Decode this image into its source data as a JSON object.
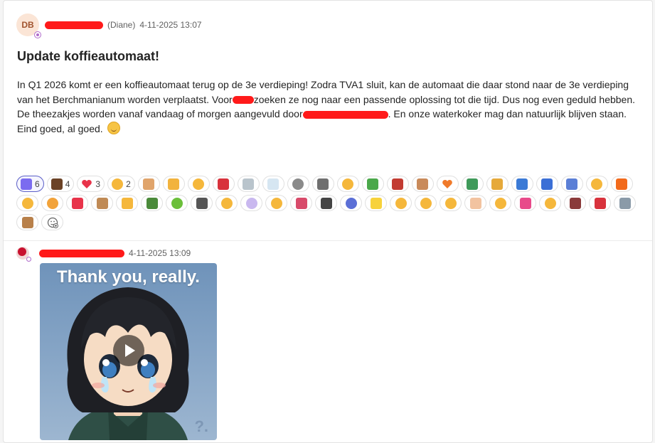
{
  "post": {
    "avatar_initials": "DB",
    "author_suffix": "(Diane)",
    "timestamp": "4-11-2025 13:07",
    "title": "Update koffieautomaat!",
    "body_line1": "In Q1 2026 komt er een koffieautomaat terug op de 3e verdieping! Zodra TVA1 sluit, kan de automaat die daar stond naar de 3e verdieping",
    "body_line2a": "van het Berchmanianum worden verplaatst. Voor",
    "body_line2b": "zoeken ze nog naar een passende oplossing tot die tijd. Dus nog even geduld hebben.",
    "body_line3a": "De theezakjes worden vanaf vandaag of morgen aangevuld door",
    "body_line3b": ". En onze waterkoker mag dan natuurlijk blijven staan.",
    "body_line4": "Eind goed, al goed."
  },
  "reactions": [
    {
      "icon": "party-popper-icon",
      "count": "6",
      "color": "#7b6cf0",
      "selected": true
    },
    {
      "icon": "coffee-icon",
      "count": "4",
      "color": "#6b4226"
    },
    {
      "icon": "heart-icon",
      "count": "3",
      "color": "#e8334a"
    },
    {
      "icon": "cat-smile-icon",
      "count": "2",
      "color": "#f5b73b"
    },
    {
      "icon": "clapping-hands-icon",
      "color": "#e0a46b"
    },
    {
      "icon": "folded-hands-icon",
      "color": "#f2b33d"
    },
    {
      "icon": "face-party-icon",
      "color": "#f5b73b"
    },
    {
      "icon": "teapot-icon",
      "color": "#d8323c"
    },
    {
      "icon": "hot-beverage-icon",
      "color": "#b9c4cc"
    },
    {
      "icon": "glass-of-milk-icon",
      "color": "#d6e6f2"
    },
    {
      "icon": "cow-face-icon",
      "color": "#8a8a8a"
    },
    {
      "icon": "cow-icon",
      "color": "#6f6f6f"
    },
    {
      "icon": "relieved-face-icon",
      "color": "#f5b73b"
    },
    {
      "icon": "seedling-icon",
      "color": "#4aa84a"
    },
    {
      "icon": "bowl-icon",
      "color": "#c23b32"
    },
    {
      "icon": "woman-bowing-icon",
      "color": "#c98a5a"
    },
    {
      "icon": "orange-heart-icon",
      "color": "#f07a2a"
    },
    {
      "icon": "lungs-icon",
      "color": "#3f9a5a"
    },
    {
      "icon": "person-bowing-icon",
      "color": "#e6a93a"
    },
    {
      "icon": "person-cartwheel-icon",
      "color": "#3b7ad6"
    },
    {
      "icon": "person-dancing-icon",
      "color": "#3b6fd6"
    },
    {
      "icon": "person-tipping-hand-icon",
      "color": "#5b7fd6"
    },
    {
      "icon": "heart-hands-icon",
      "color": "#f5b73b"
    },
    {
      "icon": "fire-icon",
      "color": "#f26a1b"
    },
    {
      "icon": "cat-grin-icon",
      "color": "#f5b73b"
    },
    {
      "icon": "lion-face-icon",
      "color": "#f2a33a"
    },
    {
      "icon": "hundred-points-icon",
      "color": "#e8334a"
    },
    {
      "icon": "potato-icon",
      "color": "#c08a55"
    },
    {
      "icon": "handshake-icon",
      "color": "#f5b73b"
    },
    {
      "icon": "champagne-icon",
      "color": "#4a8a3a"
    },
    {
      "icon": "caterpillar-icon",
      "color": "#6bbf3a"
    },
    {
      "icon": "eyes-icon",
      "color": "#555555"
    },
    {
      "icon": "glasses-face-icon",
      "color": "#f5b73b"
    },
    {
      "icon": "ghost-icon",
      "color": "#c9b8ef"
    },
    {
      "icon": "flushed-face-icon",
      "color": "#f5b73b"
    },
    {
      "icon": "circus-tent-icon",
      "color": "#d84a6a"
    },
    {
      "icon": "soon-arrow-icon",
      "color": "#444444"
    },
    {
      "icon": "scream-face-icon",
      "color": "#5b6fd6"
    },
    {
      "icon": "light-bulb-icon",
      "color": "#f7d23b"
    },
    {
      "icon": "star-struck-face-icon",
      "color": "#f5b73b"
    },
    {
      "icon": "smiling-face-icon",
      "color": "#f5b73b"
    },
    {
      "icon": "zany-face-icon",
      "color": "#f5b73b"
    },
    {
      "icon": "birthday-cake-icon",
      "color": "#f2c3a0"
    },
    {
      "icon": "sun-face-icon",
      "color": "#f5b73b"
    },
    {
      "icon": "lollipop-icon",
      "color": "#e84a8a"
    },
    {
      "icon": "sunglasses-face-icon",
      "color": "#f5b73b"
    },
    {
      "icon": "mantel-clock-icon",
      "color": "#8a3a3a"
    },
    {
      "icon": "fire-engine-icon",
      "color": "#d8323c"
    },
    {
      "icon": "flexed-biceps-icon",
      "color": "#8a9aa8"
    },
    {
      "icon": "reindeer-icon",
      "color": "#b8804a"
    },
    {
      "icon": "add-reaction-icon",
      "color": "#616161"
    }
  ],
  "reply": {
    "timestamp": "4-11-2025 13:09",
    "gif_caption": "Thank you, really.",
    "watermark": "?."
  }
}
